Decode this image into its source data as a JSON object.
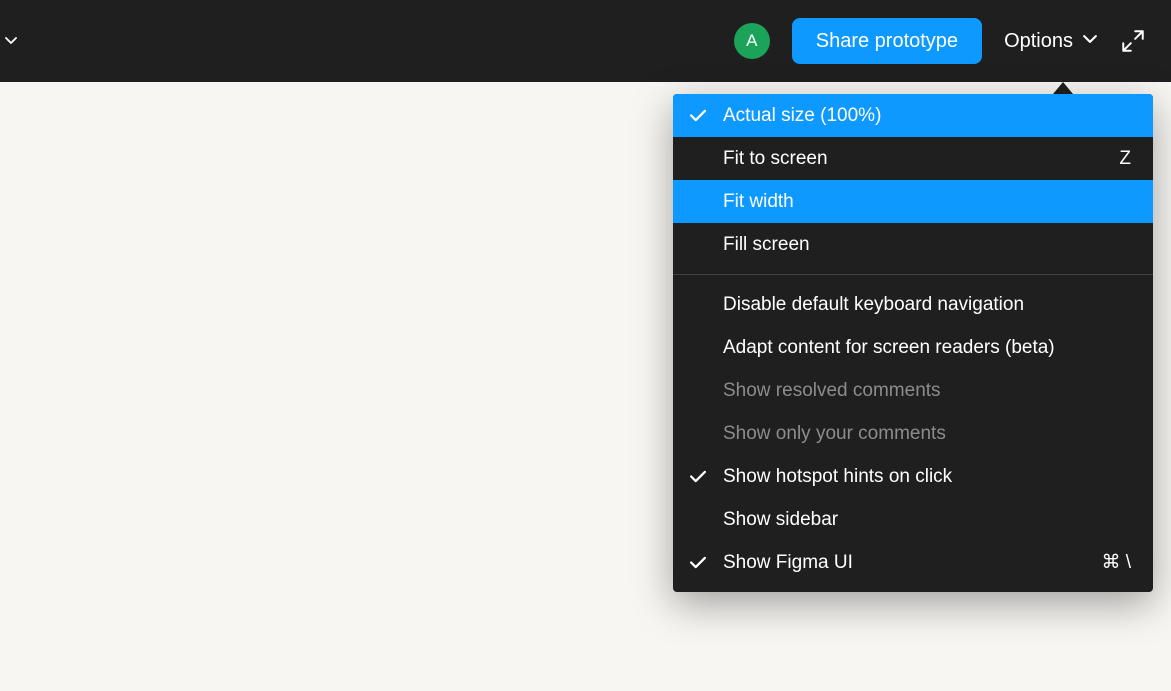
{
  "toolbar": {
    "avatar_initial": "A",
    "share_label": "Share prototype",
    "options_label": "Options"
  },
  "menu": {
    "group1": [
      {
        "label": "Actual size (100%)",
        "shortcut": "",
        "checked": true,
        "highlighted": true,
        "disabled": false
      },
      {
        "label": "Fit to screen",
        "shortcut": "Z",
        "checked": false,
        "highlighted": false,
        "disabled": false
      },
      {
        "label": "Fit width",
        "shortcut": "",
        "checked": false,
        "highlighted": true,
        "disabled": false
      },
      {
        "label": "Fill screen",
        "shortcut": "",
        "checked": false,
        "highlighted": false,
        "disabled": false
      }
    ],
    "group2": [
      {
        "label": "Disable default keyboard navigation",
        "shortcut": "",
        "checked": false,
        "highlighted": false,
        "disabled": false
      },
      {
        "label": "Adapt content for screen readers (beta)",
        "shortcut": "",
        "checked": false,
        "highlighted": false,
        "disabled": false
      },
      {
        "label": "Show resolved comments",
        "shortcut": "",
        "checked": false,
        "highlighted": false,
        "disabled": true
      },
      {
        "label": "Show only your comments",
        "shortcut": "",
        "checked": false,
        "highlighted": false,
        "disabled": true
      },
      {
        "label": "Show hotspot hints on click",
        "shortcut": "",
        "checked": true,
        "highlighted": false,
        "disabled": false
      },
      {
        "label": "Show sidebar",
        "shortcut": "",
        "checked": false,
        "highlighted": false,
        "disabled": false
      },
      {
        "label": "Show Figma UI",
        "shortcut": "⌘ \\",
        "checked": true,
        "highlighted": false,
        "disabled": false
      }
    ]
  }
}
